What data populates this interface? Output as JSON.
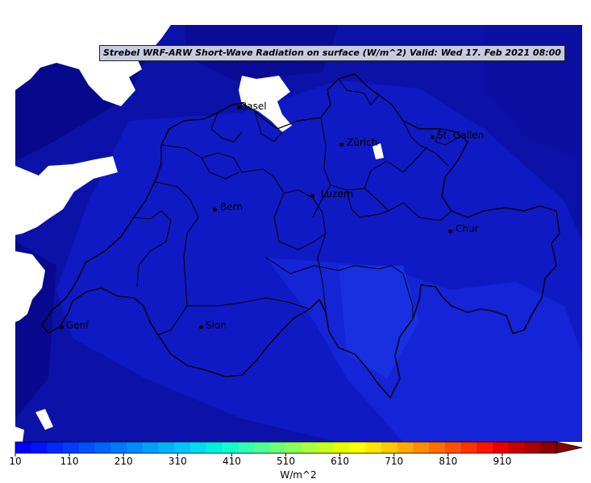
{
  "title": "Strebel WRF-ARW Short-Wave Radiation on surface (W/m^2)   Valid: Wed 17. Feb 2021 08:00",
  "cities": [
    {
      "name": "Basel"
    },
    {
      "name": "Zürich"
    },
    {
      "name": "St. Gallen"
    },
    {
      "name": "Bern"
    },
    {
      "name": "Luzern"
    },
    {
      "name": "Chur"
    },
    {
      "name": "Genf"
    },
    {
      "name": "Sion"
    }
  ],
  "colorbar": {
    "unit": "W/m^2",
    "min": 10,
    "max": 1010,
    "ticks": [
      "10",
      "110",
      "210",
      "310",
      "410",
      "510",
      "610",
      "710",
      "810",
      "910"
    ],
    "colors": [
      "#0000ff",
      "#0014ff",
      "#0028ff",
      "#003cff",
      "#0050ff",
      "#0064ff",
      "#0078ff",
      "#008cff",
      "#00a0ff",
      "#00b4ff",
      "#00c8ff",
      "#00dcf0",
      "#00f0dc",
      "#14ffc8",
      "#32ffb4",
      "#50ff96",
      "#6eff78",
      "#8cff5a",
      "#aaff3c",
      "#c8ff1e",
      "#e6ff00",
      "#ffff00",
      "#ffe600",
      "#ffc800",
      "#ffaa00",
      "#ff8c00",
      "#ff6e00",
      "#ff5000",
      "#ff3200",
      "#ff1400",
      "#e60000",
      "#c80000",
      "#aa0000",
      "#8c0000"
    ]
  },
  "colors": {
    "field_dark": "#0a0a90",
    "field_mid": "#0c14b4",
    "field_light": "#1428d8",
    "no_data": "#ffffff",
    "border": "#000000"
  }
}
